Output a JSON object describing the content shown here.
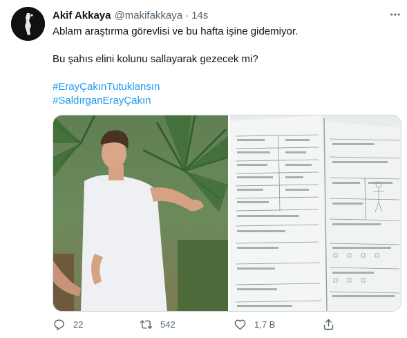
{
  "author": {
    "name": "Akif Akkaya",
    "handle": "@makifakkaya",
    "separator": "·",
    "time": "14s",
    "avatar_icon": "avatar-image"
  },
  "tweet": {
    "line1": "Ablam araştırma görevlisi ve bu hafta işine gidemiyor.",
    "line2": "Bu şahıs elini kolunu sallayarak gezecek mi?",
    "hashtag1": "#ErayÇakınTutuklansın",
    "hashtag2": "#SaldırganErayÇakın"
  },
  "media": {
    "photo1_desc": "photo-young-man-gesturing",
    "photo2_desc": "photo-medical-report-document"
  },
  "actions": {
    "reply_count": "22",
    "retweet_count": "542",
    "like_count": "1,7 B",
    "reply_icon": "reply-icon",
    "retweet_icon": "retweet-icon",
    "like_icon": "heart-icon",
    "share_icon": "share-icon",
    "more_icon": "more-options-icon"
  },
  "colors": {
    "link": "#1d9bf0",
    "secondary": "#536471",
    "text": "#0f1419"
  }
}
